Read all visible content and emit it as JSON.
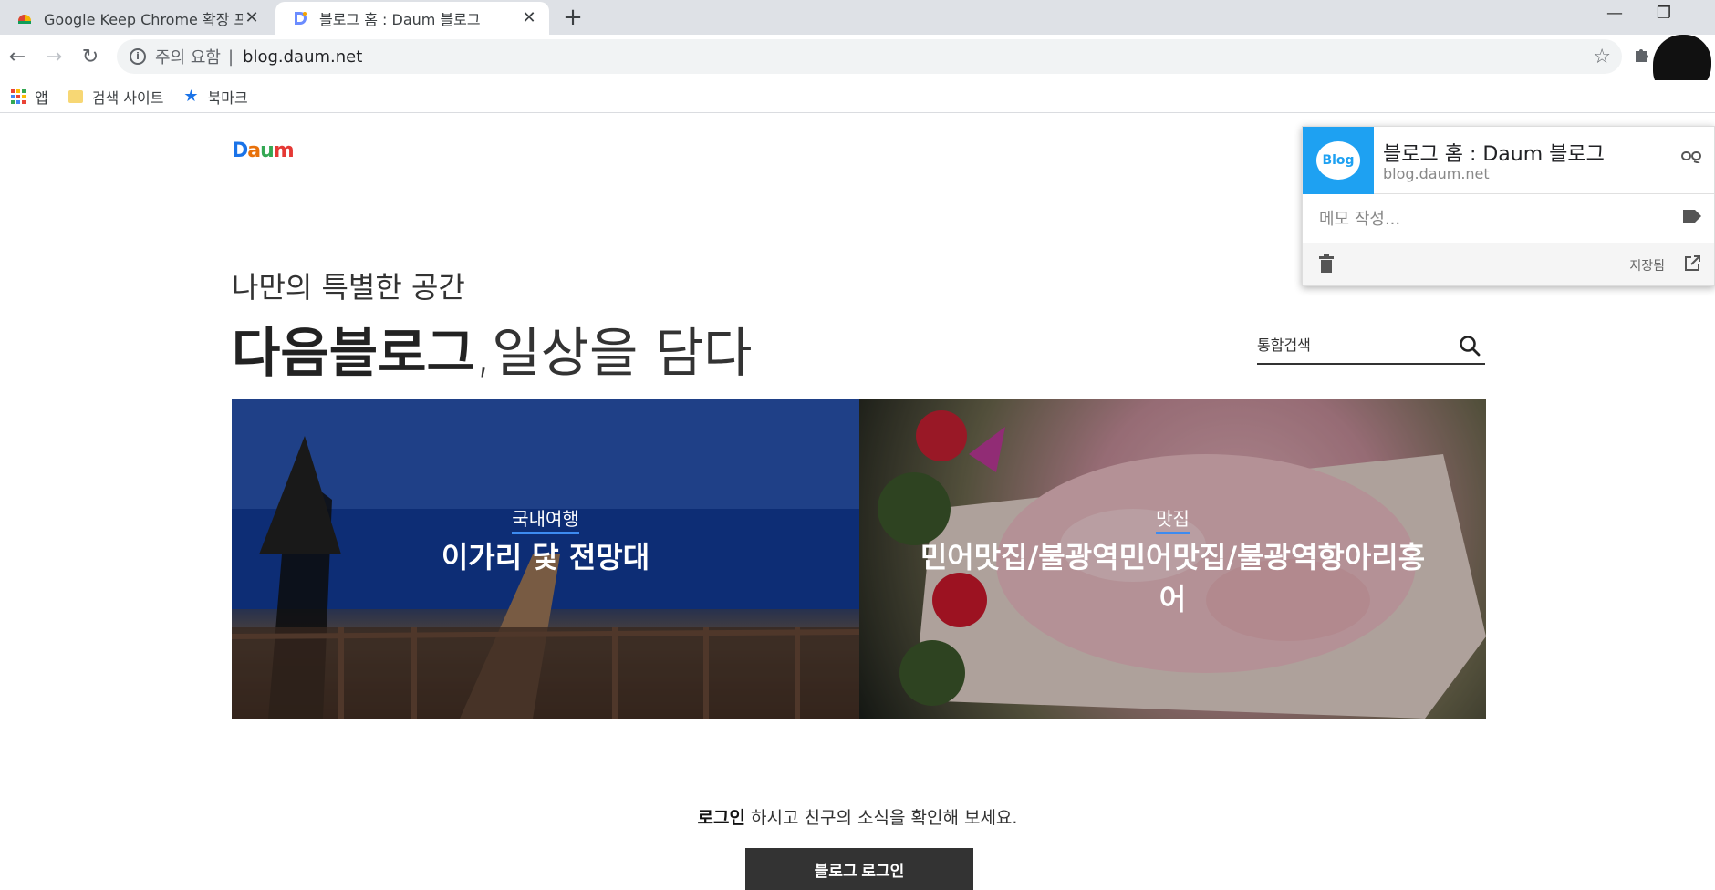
{
  "browser": {
    "tabs": [
      {
        "title": "Google Keep Chrome 확장 프로",
        "close": "✕"
      },
      {
        "title": "블로그 홈 : Daum 블로그",
        "close": "✕"
      }
    ],
    "new_tab": "+",
    "window_controls": {
      "minimize": "—",
      "restore": "❐",
      "close": "✕"
    },
    "nav": {
      "back": "←",
      "forward": "→",
      "reload": "↻"
    },
    "address": {
      "security_text": "주의 요함",
      "separator": "|",
      "url": "blog.daum.net",
      "star": "☆"
    },
    "bookmarks": [
      {
        "label": "앱",
        "icon": "apps-grid-icon"
      },
      {
        "label": "검색 사이트",
        "icon": "folder-icon"
      },
      {
        "label": "북마크",
        "icon": "star-icon"
      }
    ]
  },
  "page": {
    "logo": {
      "letters": [
        "D",
        "a",
        "u",
        "m"
      ],
      "colors": [
        "#1a73e8",
        "#e8710a",
        "#34a853",
        "#e53935"
      ]
    },
    "subtitle": "나만의 특별한 공간",
    "headline_bold": "다음블로그",
    "headline_light": ",일상을 담다",
    "search_placeholder": "통합검색",
    "features": [
      {
        "category": "국내여행",
        "title": "이가리 닻 전망대"
      },
      {
        "category": "맛집",
        "title": "민어맛집/불광역민어맛집/불광역항아리홍어"
      }
    ],
    "login_prompt_bold": "로그인",
    "login_prompt_rest": " 하시고 친구의 소식을 확인해 보세요.",
    "login_button": "블로그 로그인"
  },
  "keep_popup": {
    "thumb_label": "Blog",
    "title": "블로그 홈 : Daum 블로그",
    "url": "blog.daum.net",
    "note_placeholder": "메모 작성...",
    "saved_label": "저장됨"
  },
  "colors": {
    "tabstrip": "#dee1e6",
    "accent_blue": "#1ea1f2",
    "button_dark": "#333333"
  }
}
